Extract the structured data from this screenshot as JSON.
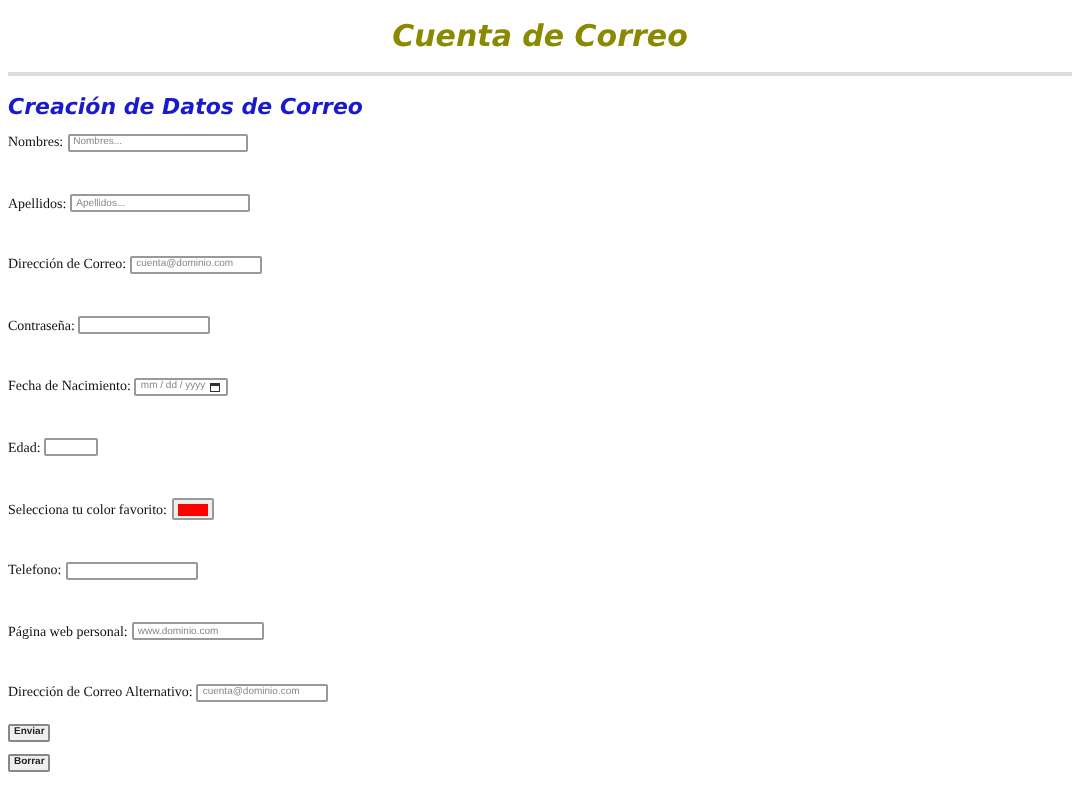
{
  "header": {
    "title": "Cuenta de Correo"
  },
  "form": {
    "heading": "Creación de Datos de Correo",
    "fields": [
      {
        "label": "Nombres:",
        "kind": "text",
        "placeholder": "Nombres..."
      },
      {
        "label": "Apellidos:",
        "kind": "text",
        "placeholder": "Apellidos..."
      },
      {
        "label": "Dirección de Correo:",
        "kind": "email",
        "placeholder": "cuenta@dominio.com"
      },
      {
        "label": "Contraseña:",
        "kind": "password"
      },
      {
        "label": "Fecha de Nacimiento:",
        "kind": "date",
        "placeholder": "mm / dd / yyyy"
      },
      {
        "label": "Edad:",
        "kind": "number"
      },
      {
        "label": "Selecciona tu color favorito:",
        "kind": "color",
        "color": "#ff0000"
      },
      {
        "label": "Telefono:",
        "kind": "tel"
      },
      {
        "label": "Página web personal:",
        "kind": "url",
        "placeholder": "www.dominio.com"
      },
      {
        "label": "Dirección de Correo Alternativo:",
        "kind": "email",
        "placeholder": "cuenta@dominio.com"
      }
    ],
    "buttons": [
      "Enviar",
      "Borrar"
    ]
  }
}
